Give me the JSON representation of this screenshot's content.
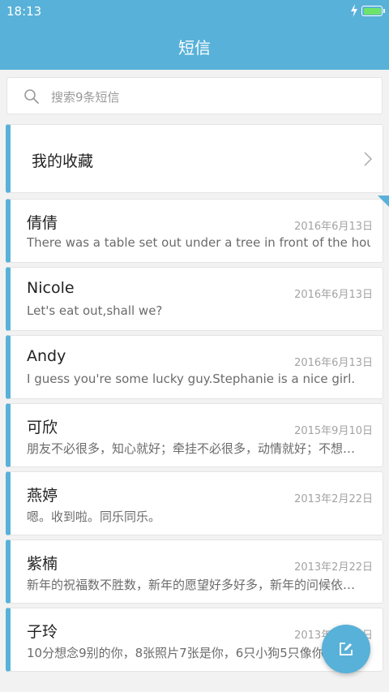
{
  "status_bar": {
    "time": "18:13"
  },
  "header": {
    "title": "短信"
  },
  "search": {
    "placeholder": "搜索9条短信"
  },
  "favorites": {
    "label": "我的收藏"
  },
  "messages": [
    {
      "name": "倩倩",
      "date": "2016年6月13日",
      "preview": "There was a table set out under a tree in front of the hous"
    },
    {
      "name": "Nicole",
      "date": "2016年6月13日",
      "preview": "Let's eat out,shall we?"
    },
    {
      "name": "Andy",
      "date": "2016年6月13日",
      "preview": "I guess you're some lucky guy.Stephanie is a nice girl."
    },
    {
      "name": "可欣",
      "date": "2015年9月10日",
      "preview": "朋友不必很多，知心就好；牵挂不必很多，动情就好；不想…"
    },
    {
      "name": "燕婷",
      "date": "2013年2月22日",
      "preview": "嗯。收到啦。同乐同乐。"
    },
    {
      "name": "紫楠",
      "date": "2013年2月22日",
      "preview": "新年的祝福数不胜数，新年的愿望好多好多，新年的问候依…"
    },
    {
      "name": "子玲",
      "date": "2013年2月22日",
      "preview": "10分想念9别的你，8张照片7张是你，6只小狗5只像你"
    }
  ],
  "colors": {
    "accent": "#58b1d8",
    "battery": "#6ee36b"
  },
  "icons": {
    "fab": "compose-icon",
    "search": "search-icon"
  }
}
